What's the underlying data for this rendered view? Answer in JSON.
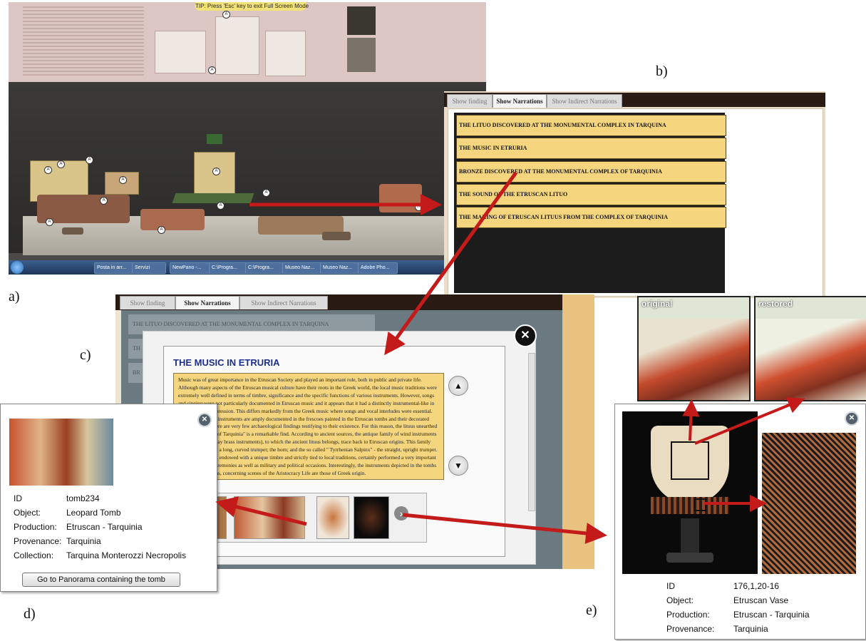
{
  "labels": {
    "a": "a)",
    "b": "b)",
    "c": "c)",
    "d": "d)",
    "e": "e)"
  },
  "panorama": {
    "tip": "TIP: Press 'Esc' key to exit Full Screen Mode",
    "taskbar_items": [
      "Posta in arr...",
      "Servizi",
      "NewPano -...",
      "C:\\Progra...",
      "C:\\Progra...",
      "Museo Naz...",
      "Museo Naz...",
      "Adobe Pho..."
    ]
  },
  "tabs": {
    "finding": "Show finding",
    "narrations": "Show Narrations",
    "indirect": "Show Indirect Narrations"
  },
  "narrations": [
    "THE LITUO DISCOVERED AT THE MONUMENTAL COMPLEX IN TARQUINA",
    "THE MUSIC IN ETRURIA",
    "BRONZE DISCOVERED AT THE MONUMENTAL COMPLEX OF TARQUINIA",
    "THE SOUND OF THE ETRUSCAN LITUO",
    "THE MAKING OF ETRUSCAN LITUUS FROM THE COMPLEX OF TARQUINIA"
  ],
  "background_rows": [
    "THE LITUO DISCOVERED AT THE MONUMENTAL COMPLEX IN TARQUINA",
    "TH",
    "BR"
  ],
  "modal": {
    "title": "THE MUSIC IN ETRURIA",
    "text": "Music was of great importance in the Etruscan Society and played an important role, both in public and private life. Although many aspects of the Etruscan musical culture have their roots in the Greek world, the local music traditions were extremely well defined in terms of timbre, significance and the specific functions of various instruments. However, songs and singing were not particularly documented in Etruscan music and it appears that it had a distinctly instrumental-like in their quality of expression. This differs markedly from the Greek music where songs and vocal interludes were essential. While the musical instruments are amply documented in the frescoes painted in the Etruscan tombs and their decorated ceramic works, there are very few archaeological findings testifying to their existence. For this reason, the lituus unearthed at the site, \"Civita of Tarquinia\" is a remarkable find. According to ancient sources, the antique family of wind instruments (perhaps modern day brass instruments), to which the ancient lituus belongs, trace back to Etruscan origins. This family includes the lituus, a long, curved trumpet; the horn; and the so called \" Tyrrhenian Salpinx\" - the straight, upright trumpet. These instruments, endowed with a unique timbre and strictly tied to local traditions, certainly performed a very important role in religious ceremonies as well as military and political occasions. Interestingly, the instruments depicted in the tombs of Ã©lite Etruscans, concerning scenes of the Aristocracy Life are those of Greek origin.",
    "up_glyph": "▲",
    "down_glyph": "▼",
    "next_glyph": "›",
    "close_glyph": "✕"
  },
  "finding_d": {
    "rows": [
      {
        "key": "ID",
        "value": "tomb234"
      },
      {
        "key": "Object:",
        "value": "Leopard Tomb"
      },
      {
        "key": "Production:",
        "value": "Etruscan - Tarquinia"
      },
      {
        "key": "Provenance:",
        "value": "Tarquinia"
      },
      {
        "key": "Collection:",
        "value": "Tarquina Monterozzi Necropolis"
      }
    ],
    "button": "Go to Panorama containing the tomb",
    "close_glyph": "✕"
  },
  "finding_e": {
    "rows": [
      {
        "key": "ID",
        "value": "176,1,20-16"
      },
      {
        "key": "Object:",
        "value": "Etruscan Vase"
      },
      {
        "key": "Production:",
        "value": "Etruscan - Tarquinia"
      },
      {
        "key": "Provenance:",
        "value": "Tarquinia"
      }
    ],
    "close_glyph": "✕"
  },
  "restoration": {
    "original": "original",
    "restored": "restored"
  },
  "colors": {
    "arrow": "#c41a1a",
    "narration_bg": "#f5d57e",
    "title_blue": "#1c2f8a"
  }
}
